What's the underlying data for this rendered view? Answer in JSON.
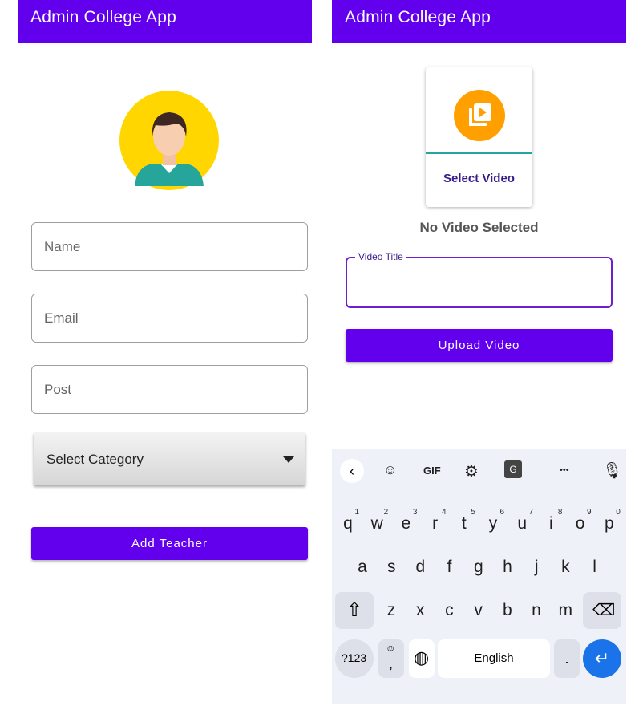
{
  "left_screen": {
    "app_title": "Admin College App",
    "fields": {
      "name_placeholder": "Name",
      "email_placeholder": "Email",
      "post_placeholder": "Post"
    },
    "category_select": "Select Category",
    "add_button": "Add Teacher"
  },
  "right_screen": {
    "app_title": "Admin College App",
    "select_video_label": "Select Video",
    "status_text": "No Video Selected",
    "video_title_label": "Video Title",
    "upload_button": "Upload Video"
  },
  "keyboard": {
    "toolbar": {
      "gif": "GIF",
      "more": "•••"
    },
    "row1": [
      {
        "k": "q",
        "n": "1"
      },
      {
        "k": "w",
        "n": "2"
      },
      {
        "k": "e",
        "n": "3"
      },
      {
        "k": "r",
        "n": "4"
      },
      {
        "k": "t",
        "n": "5"
      },
      {
        "k": "y",
        "n": "6"
      },
      {
        "k": "u",
        "n": "7"
      },
      {
        "k": "i",
        "n": "8"
      },
      {
        "k": "o",
        "n": "9"
      },
      {
        "k": "p",
        "n": "0"
      }
    ],
    "row2": [
      "a",
      "s",
      "d",
      "f",
      "g",
      "h",
      "j",
      "k",
      "l"
    ],
    "row3": [
      "z",
      "x",
      "c",
      "v",
      "b",
      "n",
      "m"
    ],
    "symbols_key": "?123",
    "comma_key": ",",
    "space_label": "English",
    "period_key": "."
  },
  "colors": {
    "app_bar": "#6200EE",
    "avatar_bg": "#FFD600",
    "video_icon_bg": "#FFA000",
    "enter_key": "#1a73e8"
  }
}
